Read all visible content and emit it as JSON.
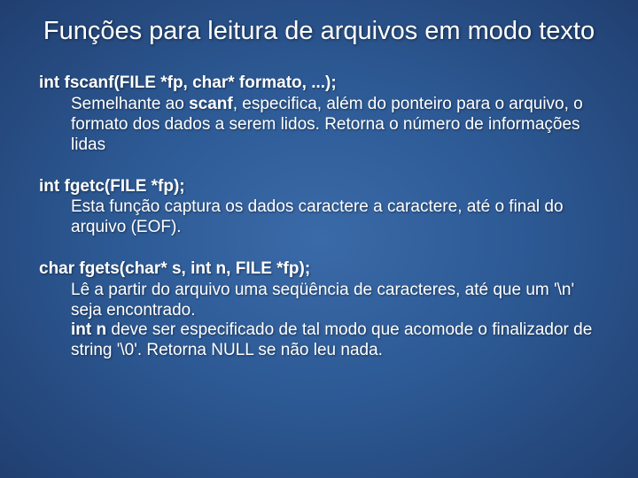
{
  "title": "Funções para leitura de arquivos em modo texto",
  "entries": [
    {
      "sig": "int fscanf(FILE *fp, char* formato, ...);",
      "desc_pre": "Semelhante ao ",
      "desc_bold": "scanf",
      "desc_post": ", especifica, além do ponteiro para o arquivo, o formato dos dados a serem lidos. Retorna o número de informações lidas"
    },
    {
      "sig": "int fgetc(FILE *fp);",
      "desc_pre": "Esta função captura os dados caractere a caractere, até o final do arquivo (EOF).",
      "desc_bold": "",
      "desc_post": ""
    },
    {
      "sig": "char fgets(char* s, int n, FILE *fp);",
      "desc_pre": "Lê a partir do arquivo uma seqüência de caracteres, até que um '\\n' seja encontrado.",
      "desc_bold": "int n",
      "desc_post": " deve ser especificado de tal modo que acomode o finalizador de string '\\0'. Retorna NULL se não leu nada.",
      "break_before_bold": true
    }
  ]
}
